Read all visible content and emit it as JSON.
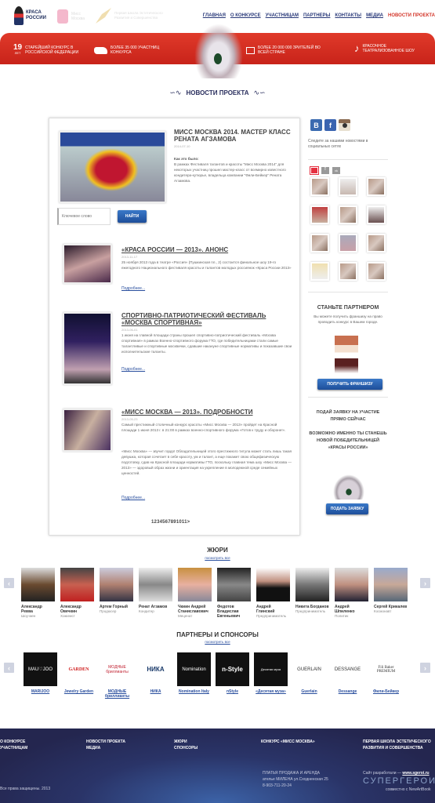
{
  "header": {
    "logos": [
      "КРАСА РОССИИ",
      "Мисс Москва",
      "Первая Школа Эстетического Развития и Совершенства"
    ],
    "nav": [
      "ГЛАВНАЯ",
      "О КОНКУРСЕ",
      "УЧАСТНИЦАМ",
      "ПАРТНЕРЫ",
      "КОНТАКТЫ",
      "МЕДИА",
      "НОВОСТИ ПРОЕКТА"
    ],
    "active_nav": "НОВОСТИ ПРОЕКТА"
  },
  "banner": {
    "years": "19",
    "years_unit": "ЛЕТ",
    "items": [
      "СТАРЕЙШИЙ КОНКУРС В РОССИЙСКОЙ ФЕДЕРАЦИИ",
      "БОЛЕЕ 35 000 УЧАСТНИЦ КОНКУРСА",
      "БОЛЕЕ 20 000 000 ЗРИТЕЛЕЙ ВО ВСЕЙ СТРАНЕ",
      "КРАСОЧНОЕ ТЕАТРАЛИЗОВАННОЕ ШОУ"
    ]
  },
  "section_title": "НОВОСТИ ПРОЕКТА",
  "featured": {
    "title": "МИСС МОСКВА 2014. МАСТЕР КЛАСС РЕНАТА АГЗАМОВА",
    "date": "2014-07-10",
    "lead": "Как это было:",
    "text": "В рамках Фестиваля талантов и красоты \"Мисс Москва 2014\" для некоторых участниц прошел мастер-класс от всемирно известного кондитера-кутюрье, владельца компании \"Фили-Бейкер\" Рената Агзамова."
  },
  "search": {
    "placeholder": "Ключевое слово",
    "button": "НАЙТИ"
  },
  "articles": [
    {
      "title": "«КРАСА РОССИИ — 2013». АНОНС",
      "date": "2013-11-17",
      "text": "25 ноября 2013 года в театре «Россия» (Пушкинская пл., 2) состоится финальное шоу 19-го ежегодного Национального фестиваля красоты и талантов молодых россиянок «Краса России 2013»",
      "more": "Подробнее..."
    },
    {
      "title": "СПОРТИВНО-ПАТРИОТИЧЕСКИЙ ФЕСТИВАЛЬ «МОСКВА СПОРТИВНАЯ»",
      "date": "2013-06-01",
      "text": "1 июня на главной площади страны прошел спортивно-патриотический фестиваль «Москва спортивная» в рамках Военно-спортивного форума ГТО, где победительницами стали самые талантливые и спортивные москвички, сдавшие накануне спортивные нормативы и показавшие свои исполнительские таланты.",
      "more": "Подробнее..."
    },
    {
      "title": "«МИСС МОСКВА — 2013». ПОДРОБНОСТИ",
      "date": "2013-05-23",
      "text": "Самый престижный столичный конкурс красоты «Мисс Москва — 2013» пройдет на Красной площади 1 июня 2013 г. в 21:00 в рамках военно-спортивного форума «Готов к труду и обороне!».",
      "text2": "«Мисс Москва» — звучит гордо! Обладательницей этого престижного титула может стать лишь такая девушка, которая сочетает в себе красоту, ум и талант, а еще покажет свою общефизическую подготовку, сдав на Красной площади нормативы ГТО, поскольку главная тема шоу «Мисс Москва — 2013» — здоровый образ жизни и ориентация на укрепление в молодежной среде семейных ценностей.",
      "more": "Подробнее..."
    }
  ],
  "pagination": "1234567891011>",
  "sidebar": {
    "social": [
      "В",
      "f",
      "ig"
    ],
    "follow_text": "Следите за нашими новостями в социальных сетях",
    "small_social": [
      "ig",
      "f",
      "vk"
    ],
    "partner_title": "СТАНЬТЕ ПАРТНЕРОМ",
    "partner_text": "Вы можете получить франшизу на право проводить конкурс в Вашем городе.",
    "partner_button": "ПОЛУЧИТЬ ФРАНШИЗУ",
    "apply_title": "ПОДАЙ ЗАЯВКУ НА УЧАСТИЕ ПРЯМО СЕЙЧАС",
    "apply_text": "ВОЗМОЖНО ИМЕННО ТЫ СТАНЕШЬ НОВОЙ ПОБЕДИТЕЛЬНИЦЕЙ «КРАСЫ РОССИИ»",
    "apply_button": "ПОДАТЬ ЗАЯВКУ"
  },
  "jury": {
    "title": "ЖЮРИ",
    "view_all": "посмотреть все",
    "members": [
      {
        "name": "Александр Ревва",
        "role": "Шоу-мен"
      },
      {
        "name": "Александр Овечкин",
        "role": "Хоккеист"
      },
      {
        "name": "Артем Горный",
        "role": "Продюсер"
      },
      {
        "name": "Ренат Агзамов",
        "role": "Кондитер"
      },
      {
        "name": "Чкиин Андрей Станиславович",
        "role": "Меценат"
      },
      {
        "name": "Федотов Владислав Евгеньевич",
        "role": ""
      },
      {
        "name": "Андрей Глинский",
        "role": "Предприниматель"
      },
      {
        "name": "Никита Богданов",
        "role": "Предприниматель"
      },
      {
        "name": "Андрей Шпиленко",
        "role": "Политик"
      },
      {
        "name": "Сергей Крикалев",
        "role": "Космонавт"
      }
    ]
  },
  "partners": {
    "title": "ПАРТНЕРЫ И СПОНСОРЫ",
    "view_all": "посмотреть все",
    "items": [
      {
        "name": "MARIJOO",
        "logo": "MAU♡JOO",
        "dark": true
      },
      {
        "name": "Jewelry Garden",
        "logo": "GARDEN",
        "dark": false
      },
      {
        "name": "МОДНЫЕ бриллианты",
        "logo": "МОДНЫЕ бриллианты",
        "dark": false
      },
      {
        "name": "НИКА",
        "logo": "НИКА",
        "dark": false
      },
      {
        "name": "Nomination Italy",
        "logo": "Nomination",
        "dark": true
      },
      {
        "name": "nStyle",
        "logo": "n-Style",
        "dark": true
      },
      {
        "name": "«Десятая муза»",
        "logo": "Десятая муза",
        "dark": true
      },
      {
        "name": "Guerlain",
        "logo": "GUERLAIN",
        "dark": false
      },
      {
        "name": "Dessange",
        "logo": "DESSANGE",
        "dark": false
      },
      {
        "name": "Фили-Бейкер",
        "logo": "Fili Baker PREMIUM",
        "dark": false
      }
    ]
  },
  "footer": {
    "col1": [
      "О КОНКУРСЕ",
      "УЧАСТНИЦАМ"
    ],
    "col2": [
      "НОВОСТИ ПРОЕКТА",
      "МЕДИА"
    ],
    "col3": [
      "ЖЮРИ",
      "СПОНСОРЫ"
    ],
    "col4": [
      "КОНКУРС «МИСС МОСКВА»"
    ],
    "col5": [
      "ПЕРВАЯ ШКОЛА ЭСТЕТИЧЕСКОГО",
      "РАЗВИТИЯ И СОВЕРШЕНСТВА"
    ],
    "copyright": "Все права защищены. 2013",
    "ad": [
      "ПЛАТЬЯ ПРОДАЖА И АРЕНДА",
      "ателье МИЛЕНА ул.Сходненская 25",
      "8-903-711-20-24"
    ],
    "dev_prefix": "Сайт разработали — ",
    "dev_link": "www.sgeroi.ru",
    "dev_logo": "СУПЕРГЕРОИ",
    "dev_with": "совместно с NewArtBook"
  },
  "colors": {
    "accent_red": "#d4382c",
    "nav_blue": "#2a3a7a",
    "button_blue": "#1e4e9a",
    "footer_navy": "#24264f"
  }
}
